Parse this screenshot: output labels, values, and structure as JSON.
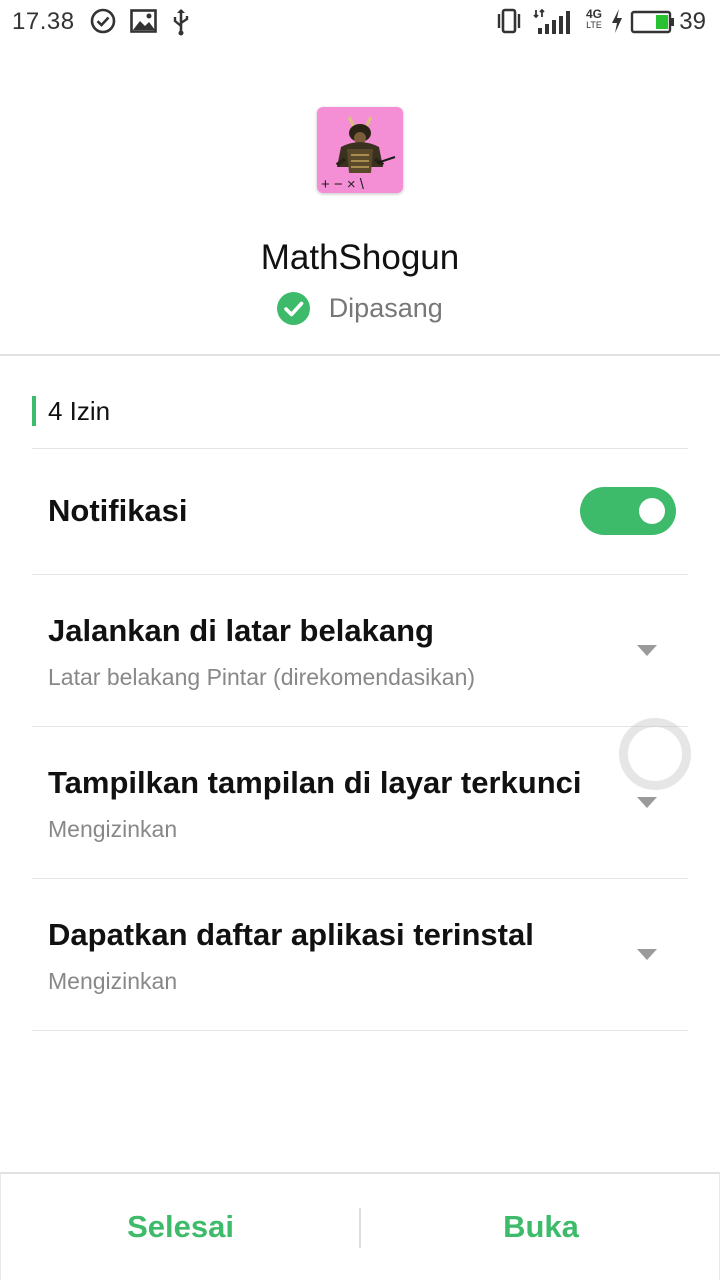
{
  "status_bar": {
    "time": "17.38",
    "battery_level": "39",
    "network_top": "4G",
    "network_bottom": "LTE",
    "left_icons": [
      "check-circle-icon",
      "image-icon",
      "usb-icon"
    ],
    "right_icons": [
      "vibrate-icon",
      "signal-icon",
      "network-4g-lte-icon",
      "charging-icon",
      "battery-icon"
    ]
  },
  "app": {
    "name": "MathShogun",
    "status": "Dipasang",
    "status_icon": "check-circle-icon",
    "icon_text": "+ − × \\"
  },
  "permissions": {
    "count_label": "4 Izin",
    "items": [
      {
        "title": "Notifikasi",
        "control": "toggle",
        "enabled": true
      },
      {
        "title": "Jalankan di latar belakang",
        "subtitle": "Latar belakang Pintar (direkomendasikan)",
        "control": "dropdown"
      },
      {
        "title": "Tampilkan tampilan di layar terkunci",
        "subtitle": "Mengizinkan",
        "control": "dropdown"
      },
      {
        "title": "Dapatkan daftar aplikasi terinstal",
        "subtitle": "Mengizinkan",
        "control": "dropdown"
      }
    ]
  },
  "buttons": {
    "done": "Selesai",
    "open": "Buka"
  },
  "colors": {
    "accent": "#3dbb6a",
    "icon_background": "#f48fd6"
  }
}
